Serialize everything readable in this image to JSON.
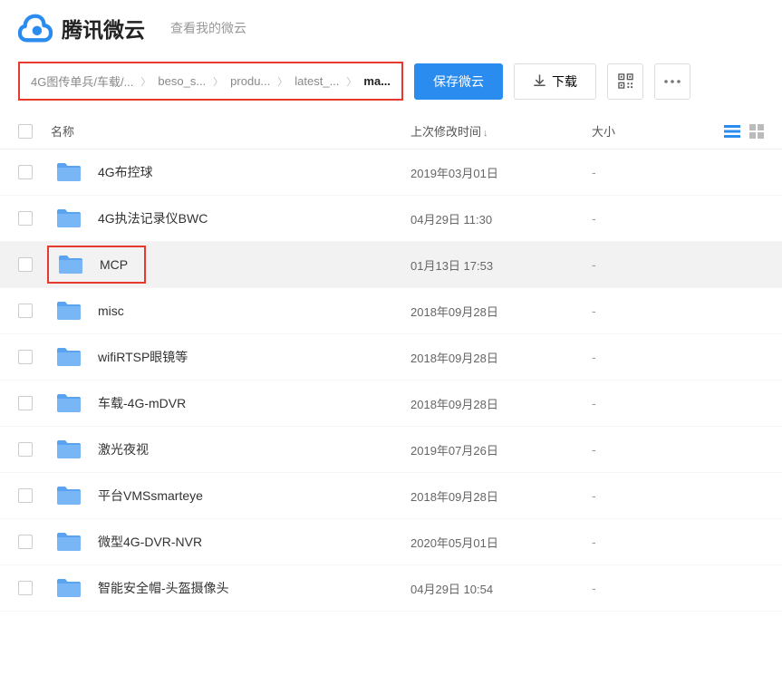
{
  "header": {
    "brand": "腾讯微云",
    "subtitle": "查看我的微云"
  },
  "breadcrumb": {
    "items": [
      {
        "label": "4G图传单兵/车载/..."
      },
      {
        "label": "beso_s..."
      },
      {
        "label": "produ..."
      },
      {
        "label": "latest_..."
      },
      {
        "label": "ma...",
        "current": true
      }
    ]
  },
  "toolbar": {
    "save_label": "保存微云",
    "download_label": "下载"
  },
  "list": {
    "columns": {
      "name": "名称",
      "time": "上次修改时间",
      "size": "大小"
    },
    "rows": [
      {
        "name": "4G布控球",
        "time": "2019年03月01日",
        "size": "-",
        "highlighted": false
      },
      {
        "name": "4G执法记录仪BWC",
        "time": "04月29日 11:30",
        "size": "-",
        "highlighted": false
      },
      {
        "name": "MCP",
        "time": "01月13日 17:53",
        "size": "-",
        "highlighted": true
      },
      {
        "name": "misc",
        "time": "2018年09月28日",
        "size": "-",
        "highlighted": false
      },
      {
        "name": "wifiRTSP眼镜等",
        "time": "2018年09月28日",
        "size": "-",
        "highlighted": false
      },
      {
        "name": "车载-4G-mDVR",
        "time": "2018年09月28日",
        "size": "-",
        "highlighted": false
      },
      {
        "name": "激光夜视",
        "time": "2019年07月26日",
        "size": "-",
        "highlighted": false
      },
      {
        "name": "平台VMSsmarteye",
        "time": "2018年09月28日",
        "size": "-",
        "highlighted": false
      },
      {
        "name": "微型4G-DVR-NVR",
        "time": "2020年05月01日",
        "size": "-",
        "highlighted": false
      },
      {
        "name": "智能安全帽-头盔摄像头",
        "time": "04月29日 10:54",
        "size": "-",
        "highlighted": false
      }
    ]
  }
}
